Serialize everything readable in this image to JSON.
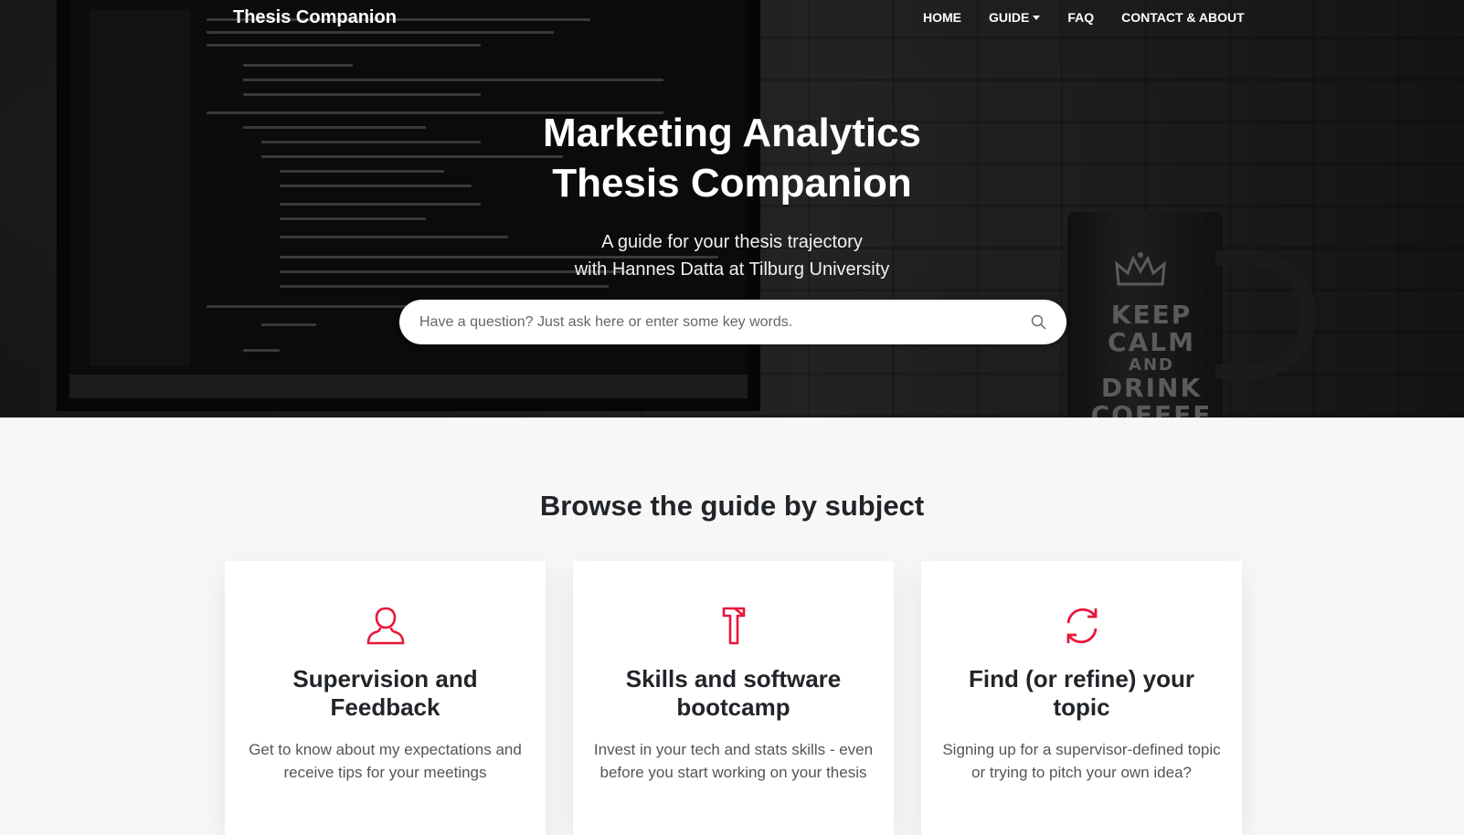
{
  "navbar": {
    "brand": "Thesis Companion",
    "links": [
      {
        "label": "HOME"
      },
      {
        "label": "GUIDE"
      },
      {
        "label": "FAQ"
      },
      {
        "label": "CONTACT & ABOUT"
      }
    ]
  },
  "hero": {
    "title_line1": "Marketing Analytics",
    "title_line2": "Thesis Companion",
    "subtitle_line1": "A guide for your thesis trajectory",
    "subtitle_line2": "with Hannes Datta at Tilburg University",
    "mug_text": [
      "KEEP",
      "CALM",
      "AND",
      "DRINK",
      "COFFEE"
    ]
  },
  "search": {
    "placeholder": "Have a question? Just ask here or enter some key words.",
    "value": ""
  },
  "browse": {
    "title": "Browse the guide by subject",
    "cards": [
      {
        "icon": "user-icon",
        "title": "Supervision and Feedback",
        "description": "Get to know about my expectations and receive tips for your meetings"
      },
      {
        "icon": "hammer-icon",
        "title": "Skills and software bootcamp",
        "description": "Invest in your tech and stats skills - even before you start working on your thesis"
      },
      {
        "icon": "refresh-icon",
        "title": "Find (or refine) your topic",
        "description": "Signing up for a supervisor-defined topic or trying to pitch your own idea?"
      }
    ]
  },
  "colors": {
    "accent": "#e8173a",
    "heading": "#212529",
    "page_bg": "#f7f7f7"
  }
}
